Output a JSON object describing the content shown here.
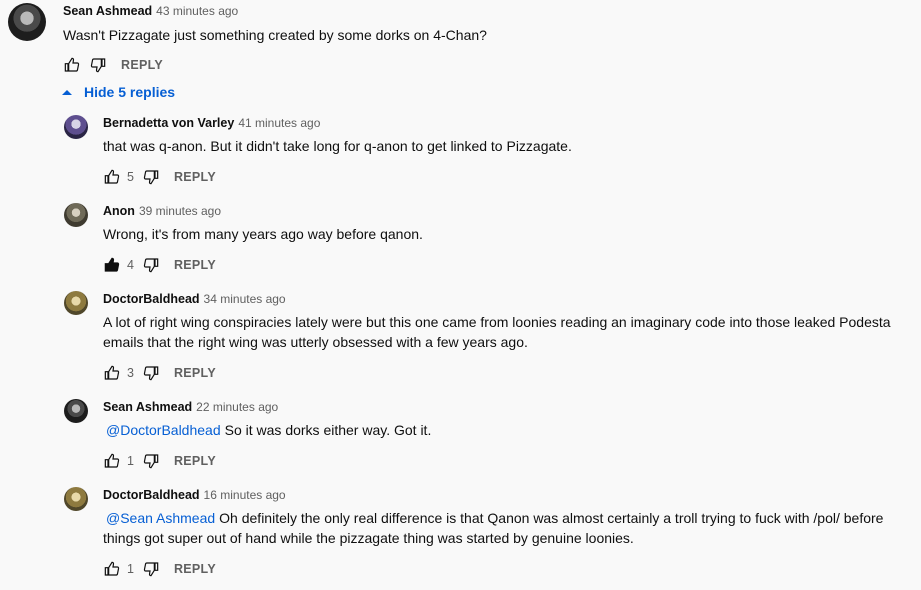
{
  "top_comment": {
    "author": "Sean Ashmead",
    "time": "43 minutes ago",
    "text": "Wasn't Pizzagate just something created by some dorks on 4-Chan?",
    "reply_label": "REPLY"
  },
  "toggle_label": "Hide 5 replies",
  "replies": [
    {
      "author": "Bernadetta von Varley",
      "time": "41 minutes ago",
      "mention": "",
      "text": "that was q-anon. But it didn't take long for q-anon to get linked to Pizzagate.",
      "likes": "5",
      "reply_label": "REPLY"
    },
    {
      "author": "Anon",
      "time": "39 minutes ago",
      "mention": "",
      "text": "Wrong, it's from many years ago way before qanon.",
      "likes": "4",
      "reply_label": "REPLY"
    },
    {
      "author": "DoctorBaldhead",
      "time": "34 minutes ago",
      "mention": "",
      "text": "A lot of right wing conspiracies lately were but this one came from loonies reading an imaginary code into those leaked Podesta emails that the right wing was utterly obsessed with a few years ago.",
      "likes": "3",
      "reply_label": "REPLY"
    },
    {
      "author": "Sean Ashmead",
      "time": "22 minutes ago",
      "mention": "@DoctorBaldhead",
      "text": "So it was dorks either way.  Got it.",
      "likes": "1",
      "reply_label": "REPLY"
    },
    {
      "author": "DoctorBaldhead",
      "time": "16 minutes ago",
      "mention": "@Sean Ashmead",
      "text": "Oh definitely the only real difference is that Qanon was almost certainly a troll trying to fuck with /pol/ before things got super out of hand while the pizzagate thing was started by genuine loonies.",
      "likes": "1",
      "reply_label": "REPLY"
    }
  ],
  "colors": {
    "link": "#065fd4",
    "secondary_text": "#606060",
    "background": "#f9f9f9"
  },
  "icons": [
    "thumbs-up-icon",
    "thumbs-down-icon",
    "caret-up-icon"
  ]
}
